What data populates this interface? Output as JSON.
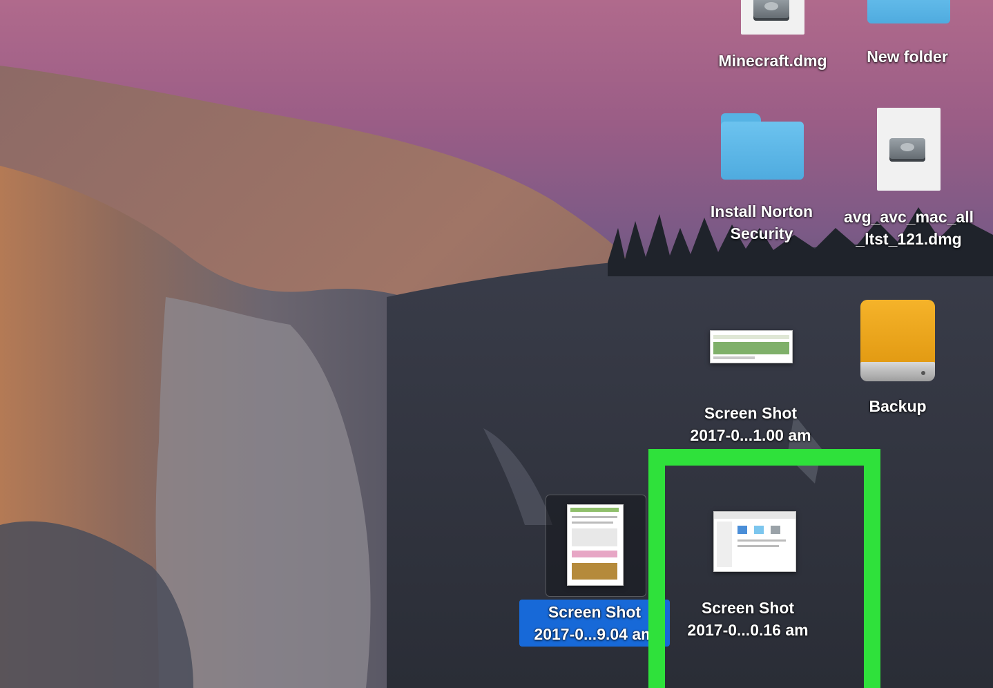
{
  "desktop": {
    "icons": [
      {
        "name": "Minecraft.dmg",
        "kind": "disk-image"
      },
      {
        "name": "New folder",
        "kind": "folder"
      },
      {
        "name_lines": [
          "Install Norton",
          "Security"
        ],
        "kind": "folder"
      },
      {
        "name_lines": [
          "avg_avc_mac_all",
          "_ltst_121.dmg"
        ],
        "kind": "disk-image"
      },
      {
        "name_lines": [
          "Screen Shot",
          "2017-0...1.00 am"
        ],
        "kind": "screenshot"
      },
      {
        "name": "Backup",
        "kind": "external-drive"
      },
      {
        "name_lines": [
          "Screen Shot",
          "2017-0...9.04 am"
        ],
        "kind": "screenshot",
        "selected": true
      },
      {
        "name_lines": [
          "Screen Shot",
          "2017-0...0.16 am"
        ],
        "kind": "screenshot",
        "highlighted": true
      }
    ]
  },
  "colors": {
    "selection_blue": "#1769d8",
    "highlight_green": "#2fe13b",
    "folder_blue": "#56b3e4",
    "drive_orange": "#f0a61e"
  }
}
